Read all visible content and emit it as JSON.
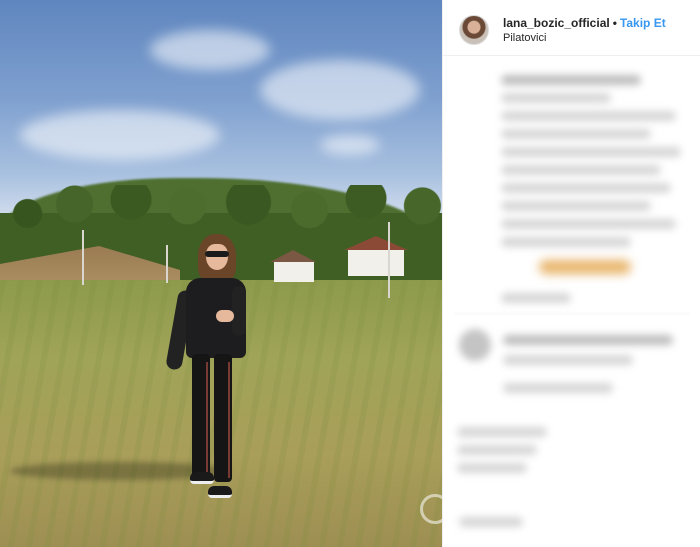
{
  "post": {
    "username": "lana_bozic_official",
    "separator": "•",
    "follow_label": "Takip Et",
    "location": "Pilatovici"
  },
  "colors": {
    "follow_blue": "#3897f0",
    "text_dark": "#262626",
    "border": "#efefef"
  },
  "icons": {
    "avatar": "profile-avatar",
    "watermark": "watermark-logo"
  }
}
